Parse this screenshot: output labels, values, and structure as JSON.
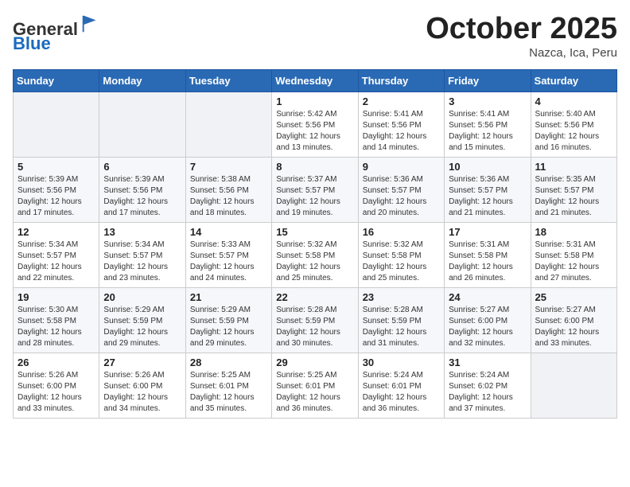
{
  "header": {
    "logo_general": "General",
    "logo_blue": "Blue",
    "month_title": "October 2025",
    "location": "Nazca, Ica, Peru"
  },
  "weekdays": [
    "Sunday",
    "Monday",
    "Tuesday",
    "Wednesday",
    "Thursday",
    "Friday",
    "Saturday"
  ],
  "weeks": [
    [
      {
        "day": "",
        "info": ""
      },
      {
        "day": "",
        "info": ""
      },
      {
        "day": "",
        "info": ""
      },
      {
        "day": "1",
        "info": "Sunrise: 5:42 AM\nSunset: 5:56 PM\nDaylight: 12 hours\nand 13 minutes."
      },
      {
        "day": "2",
        "info": "Sunrise: 5:41 AM\nSunset: 5:56 PM\nDaylight: 12 hours\nand 14 minutes."
      },
      {
        "day": "3",
        "info": "Sunrise: 5:41 AM\nSunset: 5:56 PM\nDaylight: 12 hours\nand 15 minutes."
      },
      {
        "day": "4",
        "info": "Sunrise: 5:40 AM\nSunset: 5:56 PM\nDaylight: 12 hours\nand 16 minutes."
      }
    ],
    [
      {
        "day": "5",
        "info": "Sunrise: 5:39 AM\nSunset: 5:56 PM\nDaylight: 12 hours\nand 17 minutes."
      },
      {
        "day": "6",
        "info": "Sunrise: 5:39 AM\nSunset: 5:56 PM\nDaylight: 12 hours\nand 17 minutes."
      },
      {
        "day": "7",
        "info": "Sunrise: 5:38 AM\nSunset: 5:56 PM\nDaylight: 12 hours\nand 18 minutes."
      },
      {
        "day": "8",
        "info": "Sunrise: 5:37 AM\nSunset: 5:57 PM\nDaylight: 12 hours\nand 19 minutes."
      },
      {
        "day": "9",
        "info": "Sunrise: 5:36 AM\nSunset: 5:57 PM\nDaylight: 12 hours\nand 20 minutes."
      },
      {
        "day": "10",
        "info": "Sunrise: 5:36 AM\nSunset: 5:57 PM\nDaylight: 12 hours\nand 21 minutes."
      },
      {
        "day": "11",
        "info": "Sunrise: 5:35 AM\nSunset: 5:57 PM\nDaylight: 12 hours\nand 21 minutes."
      }
    ],
    [
      {
        "day": "12",
        "info": "Sunrise: 5:34 AM\nSunset: 5:57 PM\nDaylight: 12 hours\nand 22 minutes."
      },
      {
        "day": "13",
        "info": "Sunrise: 5:34 AM\nSunset: 5:57 PM\nDaylight: 12 hours\nand 23 minutes."
      },
      {
        "day": "14",
        "info": "Sunrise: 5:33 AM\nSunset: 5:57 PM\nDaylight: 12 hours\nand 24 minutes."
      },
      {
        "day": "15",
        "info": "Sunrise: 5:32 AM\nSunset: 5:58 PM\nDaylight: 12 hours\nand 25 minutes."
      },
      {
        "day": "16",
        "info": "Sunrise: 5:32 AM\nSunset: 5:58 PM\nDaylight: 12 hours\nand 25 minutes."
      },
      {
        "day": "17",
        "info": "Sunrise: 5:31 AM\nSunset: 5:58 PM\nDaylight: 12 hours\nand 26 minutes."
      },
      {
        "day": "18",
        "info": "Sunrise: 5:31 AM\nSunset: 5:58 PM\nDaylight: 12 hours\nand 27 minutes."
      }
    ],
    [
      {
        "day": "19",
        "info": "Sunrise: 5:30 AM\nSunset: 5:58 PM\nDaylight: 12 hours\nand 28 minutes."
      },
      {
        "day": "20",
        "info": "Sunrise: 5:29 AM\nSunset: 5:59 PM\nDaylight: 12 hours\nand 29 minutes."
      },
      {
        "day": "21",
        "info": "Sunrise: 5:29 AM\nSunset: 5:59 PM\nDaylight: 12 hours\nand 29 minutes."
      },
      {
        "day": "22",
        "info": "Sunrise: 5:28 AM\nSunset: 5:59 PM\nDaylight: 12 hours\nand 30 minutes."
      },
      {
        "day": "23",
        "info": "Sunrise: 5:28 AM\nSunset: 5:59 PM\nDaylight: 12 hours\nand 31 minutes."
      },
      {
        "day": "24",
        "info": "Sunrise: 5:27 AM\nSunset: 6:00 PM\nDaylight: 12 hours\nand 32 minutes."
      },
      {
        "day": "25",
        "info": "Sunrise: 5:27 AM\nSunset: 6:00 PM\nDaylight: 12 hours\nand 33 minutes."
      }
    ],
    [
      {
        "day": "26",
        "info": "Sunrise: 5:26 AM\nSunset: 6:00 PM\nDaylight: 12 hours\nand 33 minutes."
      },
      {
        "day": "27",
        "info": "Sunrise: 5:26 AM\nSunset: 6:00 PM\nDaylight: 12 hours\nand 34 minutes."
      },
      {
        "day": "28",
        "info": "Sunrise: 5:25 AM\nSunset: 6:01 PM\nDaylight: 12 hours\nand 35 minutes."
      },
      {
        "day": "29",
        "info": "Sunrise: 5:25 AM\nSunset: 6:01 PM\nDaylight: 12 hours\nand 36 minutes."
      },
      {
        "day": "30",
        "info": "Sunrise: 5:24 AM\nSunset: 6:01 PM\nDaylight: 12 hours\nand 36 minutes."
      },
      {
        "day": "31",
        "info": "Sunrise: 5:24 AM\nSunset: 6:02 PM\nDaylight: 12 hours\nand 37 minutes."
      },
      {
        "day": "",
        "info": ""
      }
    ]
  ]
}
